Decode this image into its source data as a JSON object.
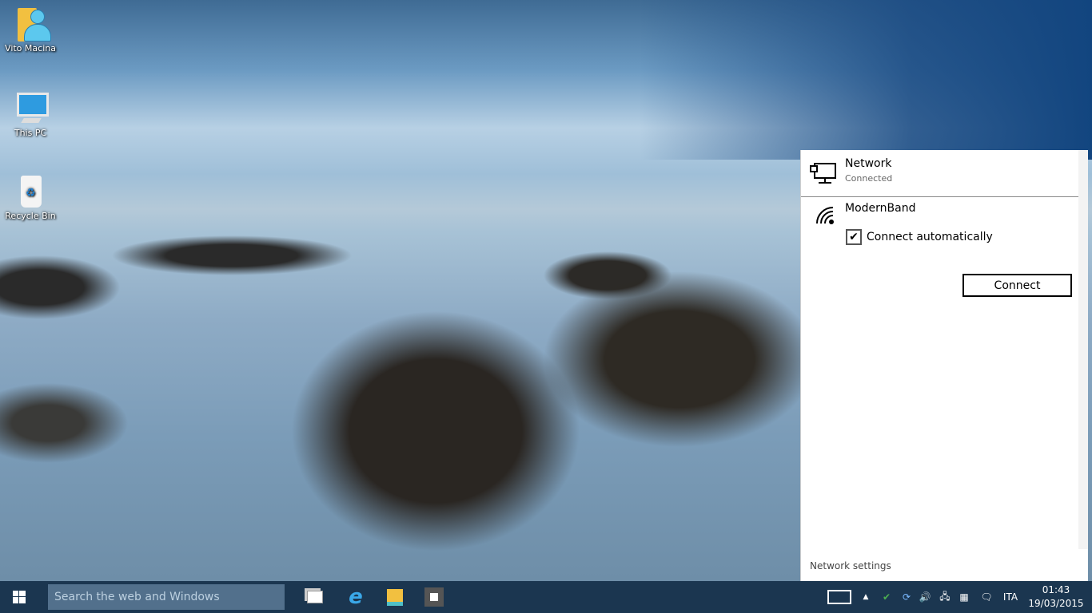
{
  "desktop": {
    "icons": [
      {
        "label": "Vito Macina",
        "icon": "user-folder-icon"
      },
      {
        "label": "This PC",
        "icon": "computer-icon"
      },
      {
        "label": "Recycle Bin",
        "icon": "recycle-bin-icon"
      }
    ]
  },
  "flyout": {
    "connected": {
      "name": "Network",
      "status": "Connected",
      "icon": "wired-network-icon"
    },
    "wifi": {
      "name": "ModernBand",
      "icon": "wifi-icon",
      "auto_label": "Connect automatically",
      "auto_checked": true,
      "connect_label": "Connect"
    },
    "settings_label": "Network settings"
  },
  "taskbar": {
    "search_placeholder": "Search the web and Windows",
    "apps": [
      "task-view-icon",
      "internet-explorer-icon",
      "file-explorer-icon",
      "store-icon"
    ],
    "tray": {
      "language": "ITA",
      "time": "01:43",
      "date": "19/03/2015"
    }
  }
}
